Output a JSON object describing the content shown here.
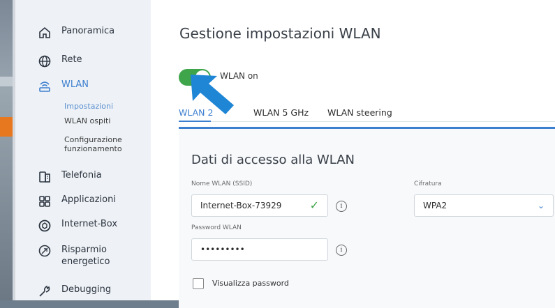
{
  "sidebar": {
    "items": [
      {
        "label": "Panoramica",
        "icon": "home-icon"
      },
      {
        "label": "Rete",
        "icon": "globe-icon"
      },
      {
        "label": "WLAN",
        "icon": "wifi-router-icon"
      },
      {
        "label": "Telefonia",
        "icon": "phone-icon"
      },
      {
        "label": "Applicazioni",
        "icon": "apps-grid-icon"
      },
      {
        "label": "Internet-Box",
        "icon": "box-icon"
      },
      {
        "label": "Risparmio energetico",
        "label_line1": "Risparmio",
        "label_line2": "energetico",
        "icon": "leaf-icon"
      },
      {
        "label": "Debugging",
        "icon": "wrench-icon"
      }
    ],
    "wlan_sub": [
      {
        "label": "Impostazioni"
      },
      {
        "label": "WLAN ospiti"
      },
      {
        "label": "Configurazione funzionamento",
        "line1": "Configurazione",
        "line2": "funzionamento"
      }
    ]
  },
  "main": {
    "title": "Gestione impostazioni WLAN",
    "toggle": {
      "label": "WLAN on",
      "on": true
    },
    "tabs": [
      {
        "label": "WLAN 2.4 GHz",
        "visible": "WLAN 2"
      },
      {
        "label": "WLAN 5 GHz",
        "visible": "WLAN 5 GHz"
      },
      {
        "label": "WLAN steering"
      }
    ],
    "card": {
      "title": "Dati di accesso alla WLAN",
      "ssid_label": "Nome WLAN (SSID)",
      "ssid_value": "Internet-Box-73929",
      "cipher_label": "Cifratura",
      "cipher_value": "WPA2",
      "password_label": "Password WLAN",
      "password_value": "•••••••••",
      "show_password_label": "Visualizza password"
    }
  },
  "colors": {
    "accent": "#3d7fcf",
    "toggle_on": "#3fa54a",
    "arrow": "#1f86d6"
  }
}
